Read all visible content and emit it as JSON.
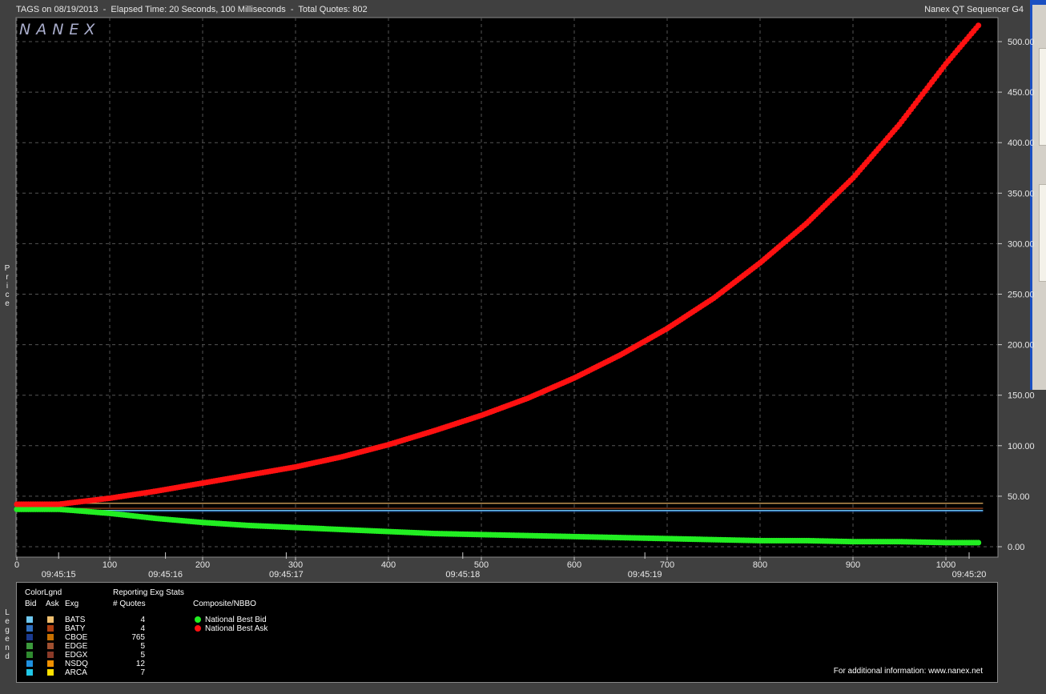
{
  "header": {
    "title_left": "TAGS on 08/19/2013  -  Elapsed Time: 20 Seconds, 100 Milliseconds  -  Total Quotes: 802",
    "title_right": "Nanex QT Sequencer G4"
  },
  "logo_text": "NANEX",
  "axis_side_label": "Price",
  "legend_side_label": "Legend",
  "chart_data": {
    "type": "scatter",
    "xlim": [
      0,
      1050
    ],
    "ylim": [
      0,
      520
    ],
    "x_ticks": [
      0,
      100,
      200,
      300,
      400,
      500,
      600,
      700,
      800,
      900,
      1000
    ],
    "y_ticks": [
      "0.00",
      "50.00",
      "100.00",
      "150.00",
      "200.00",
      "250.00",
      "300.00",
      "350.00",
      "400.00",
      "450.00",
      "500.00"
    ],
    "time_ticks": [
      {
        "label": "09:45:15",
        "x": 45
      },
      {
        "label": "09:45:16",
        "x": 160
      },
      {
        "label": "09:45:17",
        "x": 290
      },
      {
        "label": "09:45:18",
        "x": 480
      },
      {
        "label": "09:45:19",
        "x": 676
      },
      {
        "label": "09:45:20",
        "x": 1025
      }
    ],
    "grid": true,
    "series": [
      {
        "name": "National Best Bid",
        "color": "#22ee22",
        "x": [
          0,
          45,
          60,
          100,
          150,
          200,
          250,
          300,
          350,
          400,
          450,
          500,
          550,
          600,
          650,
          700,
          750,
          800,
          850,
          900,
          950,
          1000,
          1035
        ],
        "y": [
          37,
          37,
          36,
          33,
          28,
          24,
          21,
          19,
          17,
          15,
          13,
          12,
          11,
          10,
          9,
          8,
          7,
          6,
          6,
          5,
          5,
          4,
          4
        ]
      },
      {
        "name": "National Best Ask",
        "color": "#ff1111",
        "x": [
          0,
          45,
          100,
          150,
          200,
          250,
          300,
          350,
          400,
          450,
          500,
          550,
          600,
          650,
          700,
          750,
          800,
          850,
          900,
          950,
          1000,
          1035
        ],
        "y": [
          42,
          42,
          48,
          55,
          63,
          71,
          79,
          89,
          101,
          115,
          130,
          147,
          167,
          190,
          216,
          246,
          281,
          320,
          365,
          418,
          478,
          516
        ]
      }
    ],
    "horizontal_lines": [
      {
        "y": 43,
        "color": "#e6b060"
      },
      {
        "y": 38,
        "color": "#b05020"
      },
      {
        "y": 36,
        "color": "#6fc8f0"
      },
      {
        "y": 35,
        "color": "#3070c0"
      }
    ]
  },
  "legend": {
    "color_legend_title": "ColorLgnd",
    "col_bid": "Bid",
    "col_ask": "Ask",
    "col_exg": "Exg",
    "stats_title": "Reporting Exg Stats",
    "stats_col": "# Quotes",
    "composite_title": "Composite/NBBO",
    "exchanges": [
      {
        "name": "BATS",
        "quotes": "4",
        "bid_color": "#6fc8f0",
        "ask_color": "#f0c070"
      },
      {
        "name": "BATY",
        "quotes": "4",
        "bid_color": "#3070c0",
        "ask_color": "#b04010"
      },
      {
        "name": "CBOE",
        "quotes": "765",
        "bid_color": "#1a3a90",
        "ask_color": "#c87000"
      },
      {
        "name": "EDGE",
        "quotes": "5",
        "bid_color": "#3c9a3c",
        "ask_color": "#a05030"
      },
      {
        "name": "EDGX",
        "quotes": "5",
        "bid_color": "#2f8a2f",
        "ask_color": "#8a3a28"
      },
      {
        "name": "NSDQ",
        "quotes": "12",
        "bid_color": "#1e90e0",
        "ask_color": "#f09000"
      },
      {
        "name": "ARCA",
        "quotes": "7",
        "bid_color": "#20c8e8",
        "ask_color": "#ffe000"
      }
    ],
    "composite": [
      {
        "label": "National Best Bid",
        "color": "#22ee22"
      },
      {
        "label": "National Best Ask",
        "color": "#ff1111"
      }
    ],
    "footer": "For additional information: www.nanex.net"
  }
}
